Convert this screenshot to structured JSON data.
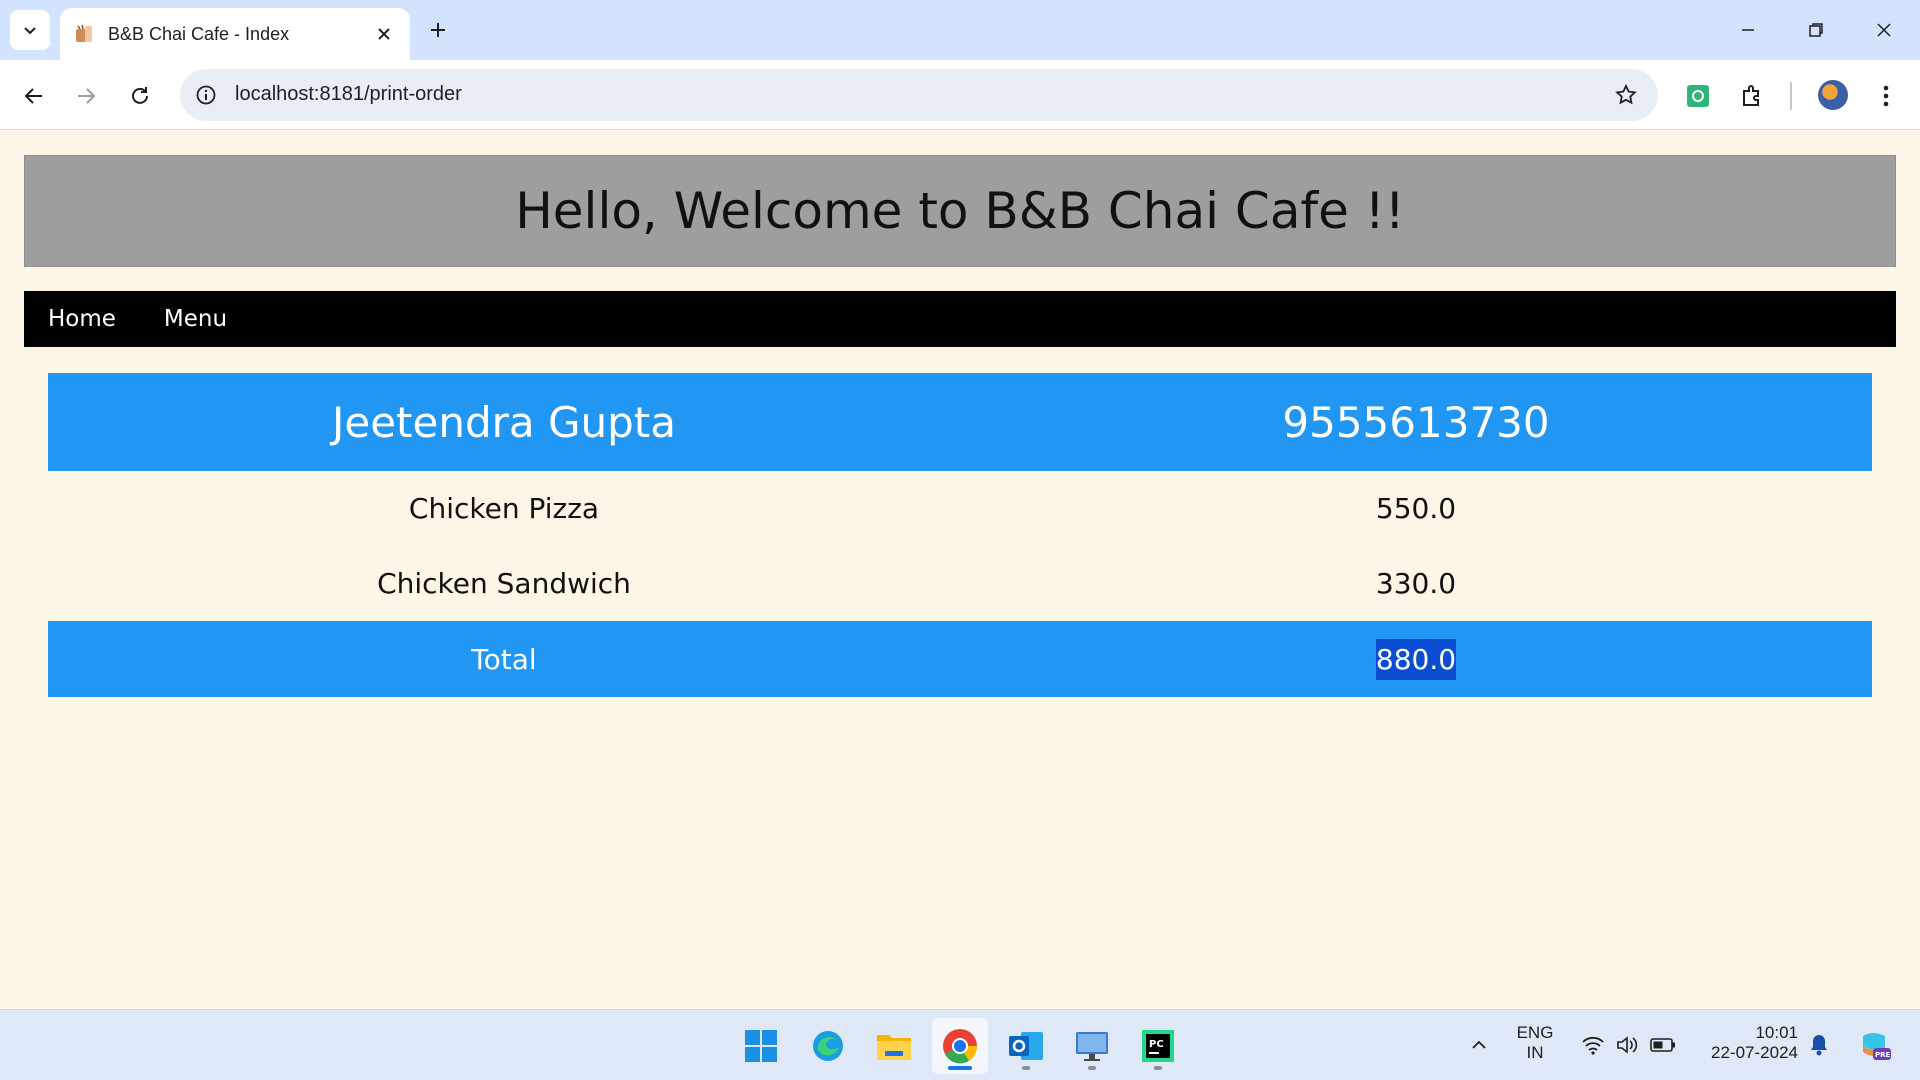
{
  "browser": {
    "tab_title": "B&B Chai Cafe - Index",
    "url": "localhost:8181/print-order"
  },
  "page": {
    "header_title": "Hello, Welcome to B&B Chai Cafe !!",
    "nav": [
      {
        "label": "Home"
      },
      {
        "label": "Menu"
      }
    ],
    "order": {
      "customer_name": "Jeetendra Gupta",
      "phone": "9555613730",
      "items": [
        {
          "name": "Chicken Pizza",
          "price": "550.0"
        },
        {
          "name": "Chicken Sandwich",
          "price": "330.0"
        }
      ],
      "total_label": "Total",
      "total_value": "880.0"
    }
  },
  "colors": {
    "page_bg": "#fdf5e6",
    "header_bg": "#9e9e9e",
    "nav_bg": "#000000",
    "accent_blue": "#2196f3",
    "selection": "#0b4dd1"
  },
  "taskbar": {
    "apps": [
      "windows-start-icon",
      "edge-icon",
      "file-explorer-icon",
      "chrome-icon",
      "outlook-icon",
      "remote-desktop-icon",
      "pycharm-icon"
    ],
    "language_line1": "ENG",
    "language_line2": "IN",
    "time": "10:01",
    "date": "22-07-2024"
  }
}
